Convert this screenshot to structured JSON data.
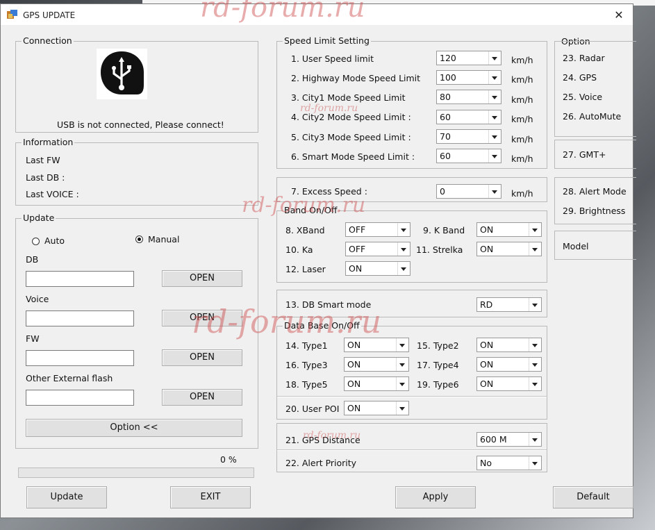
{
  "watermark": "rd-forum.ru",
  "window": {
    "title": "GPS UPDATE",
    "close_glyph": "✕"
  },
  "connection": {
    "title": "Connection",
    "icon": "usb-icon",
    "status": "USB is not connected, Please connect!"
  },
  "information": {
    "title": "Information",
    "last_fw": "Last FW",
    "last_db": "Last DB :",
    "last_voice": "Last VOICE :"
  },
  "update": {
    "title": "Update",
    "auto_label": "Auto",
    "manual_label": "Manual",
    "db_label": "DB",
    "voice_label": "Voice",
    "fw_label": "FW",
    "other_label": "Other External flash",
    "open_label": "OPEN",
    "option_button": "Option <<",
    "progress_text": "0 %",
    "progress_value": 0
  },
  "speed_limit": {
    "title": "Speed Limit Setting",
    "unit": "km/h",
    "rows": [
      {
        "label": "1. User Speed limit",
        "value": "120"
      },
      {
        "label": "2. Highway Mode Speed Limit",
        "value": "100"
      },
      {
        "label": "3. City1 Mode Speed Limit",
        "value": "80"
      },
      {
        "label": "4. City2 Mode Speed Limit :",
        "value": "60"
      },
      {
        "label": "5. City3 Mode Speed Limit :",
        "value": "70"
      },
      {
        "label": "6. Smart Mode Speed Limit :",
        "value": "60"
      }
    ]
  },
  "excess": {
    "label": "7. Excess Speed :",
    "value": "0",
    "unit": "km/h"
  },
  "band": {
    "title": "Band On/Off",
    "items": [
      {
        "label": "8. XBand",
        "value": "OFF"
      },
      {
        "label": "9. K Band",
        "value": "ON"
      },
      {
        "label": "10. Ka",
        "value": "OFF"
      },
      {
        "label": "11. Strelka",
        "value": "ON"
      },
      {
        "label": "12. Laser",
        "value": "ON"
      }
    ]
  },
  "db_smart": {
    "label": "13. DB Smart mode",
    "value": "RD"
  },
  "data_base": {
    "title": "Data Base On/Off",
    "items": [
      {
        "label": "14. Type1",
        "value": "ON"
      },
      {
        "label": "15. Type2",
        "value": "ON"
      },
      {
        "label": "16. Type3",
        "value": "ON"
      },
      {
        "label": "17. Type4",
        "value": "ON"
      },
      {
        "label": "18. Type5",
        "value": "ON"
      },
      {
        "label": "19. Type6",
        "value": "ON"
      }
    ],
    "user_poi_label": "20. User POI",
    "user_poi_value": "ON"
  },
  "gps_distance": {
    "label": "21. GPS Distance",
    "value": "600 M"
  },
  "alert_priority": {
    "label": "22. Alert Priority",
    "value": "No"
  },
  "option": {
    "title": "Option",
    "items": [
      "23. Radar",
      "24. GPS",
      "25. Voice",
      "26. AutoMute",
      "27. GMT+",
      "28. Alert Mode",
      "29. Brightness",
      "Model"
    ]
  },
  "footer": {
    "update": "Update",
    "exit": "EXIT",
    "apply": "Apply",
    "default": "Default"
  }
}
